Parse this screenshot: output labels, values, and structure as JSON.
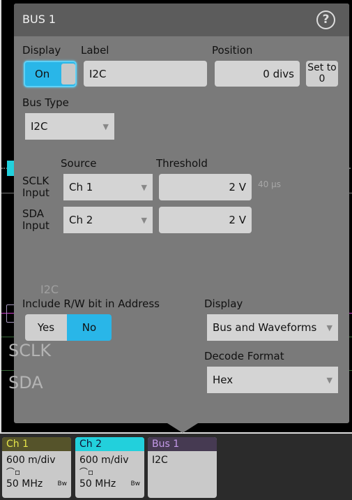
{
  "background": {
    "trace_labels": [
      "I2C",
      "SCLK",
      "SDA"
    ],
    "time_label": "40 µs"
  },
  "panel": {
    "title": "BUS 1",
    "help_icon": "help-circle-icon",
    "display": {
      "label": "Display",
      "value": "On"
    },
    "label": {
      "label": "Label",
      "value": "I2C"
    },
    "position": {
      "label": "Position",
      "value": "0 divs",
      "set_zero": "Set to 0"
    },
    "bus_type": {
      "label": "Bus Type",
      "value": "I2C"
    },
    "source_header": "Source",
    "threshold_header": "Threshold",
    "sclk": {
      "label": "SCLK Input",
      "source": "Ch 1",
      "threshold": "2 V"
    },
    "sda": {
      "label": "SDA Input",
      "source": "Ch 2",
      "threshold": "2 V"
    },
    "rw_bit": {
      "label": "Include R/W bit in Address",
      "yes": "Yes",
      "no": "No",
      "selected": "No"
    },
    "display_mode": {
      "label": "Display",
      "value": "Bus and Waveforms"
    },
    "decode_format": {
      "label": "Decode Format",
      "value": "Hex"
    }
  },
  "badges": [
    {
      "title": "Ch 1",
      "scale": "600 m/div",
      "bandwidth": "50 MHz",
      "bw": "Bw",
      "color": "#55532a",
      "text_color": "#e6e64a"
    },
    {
      "title": "Ch 2",
      "scale": "600 m/div",
      "bandwidth": "50 MHz",
      "bw": "Bw",
      "color": "#22d0dc",
      "text_color": "#113"
    },
    {
      "title": "Bus 1",
      "value": "I2C",
      "color": "#463a52",
      "text_color": "#c49ae8"
    }
  ],
  "colors": {
    "accent": "#29b6e8",
    "panel": "#7a7a7a"
  }
}
